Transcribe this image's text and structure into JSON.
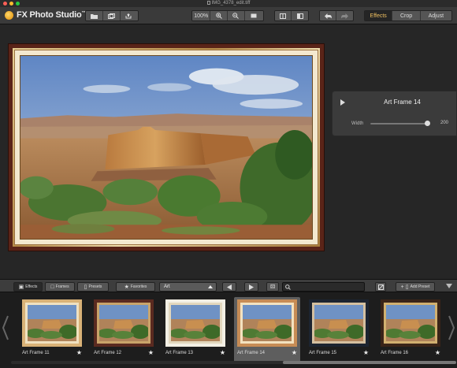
{
  "window": {
    "title": "IMG_4378_edit.tiff"
  },
  "app": {
    "name": "FX Photo Studio",
    "trademark": "™"
  },
  "toolbar": {
    "zoom_value": "100%",
    "tabs": [
      {
        "label": "Effects",
        "active": true
      },
      {
        "label": "Crop",
        "active": false
      },
      {
        "label": "Adjust",
        "active": false
      }
    ]
  },
  "effect_panel": {
    "title": "Art Frame 14",
    "param_label": "Width",
    "param_value": "200",
    "param_fraction": 0.95
  },
  "browser": {
    "tabs": [
      {
        "label": "Effects",
        "icon": "fx-icon",
        "active": true
      },
      {
        "label": "Frames",
        "icon": "frame-icon",
        "active": false
      },
      {
        "label": "Presets",
        "icon": "folder-icon",
        "active": false
      }
    ],
    "favorites_label": "Favorites",
    "category": "Art",
    "search_placeholder": "",
    "add_preset_label": "Add Preset",
    "thumbnails": [
      {
        "label": "Art Frame 11",
        "frame_color": "#d9b277",
        "inner": "#f0e1c0",
        "selected": false
      },
      {
        "label": "Art Frame 12",
        "frame_color": "#5a2a20",
        "inner": "#c9a46a",
        "selected": false
      },
      {
        "label": "Art Frame 13",
        "frame_color": "#f2efe4",
        "inner": "#e2d7bd",
        "selected": false
      },
      {
        "label": "Art Frame 14",
        "frame_color": "#c78c55",
        "inner": "#f3e2c0",
        "selected": true
      },
      {
        "label": "Art Frame 15",
        "frame_color": "#1c2430",
        "inner": "#d4c0a0",
        "selected": false
      },
      {
        "label": "Art Frame 16",
        "frame_color": "#3a2418",
        "inner": "#d2b070",
        "selected": false
      }
    ],
    "scroll_fraction": 0.62
  },
  "colors": {
    "accent": "#f0c060",
    "light_close": "#ff5f57",
    "light_min": "#febc2e",
    "light_max": "#28c840"
  }
}
